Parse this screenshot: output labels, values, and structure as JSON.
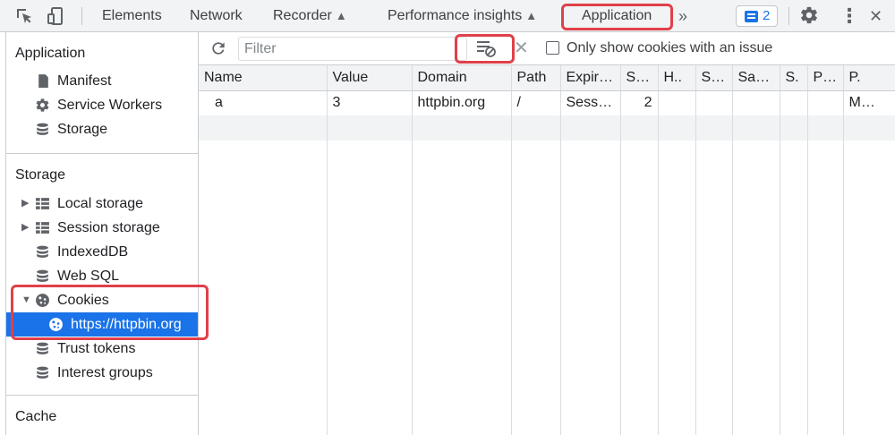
{
  "toolbar": {
    "tabs": [
      {
        "label": "Elements"
      },
      {
        "label": "Network"
      },
      {
        "label": "Recorder",
        "experimental": true
      },
      {
        "label": "Performance insights",
        "experimental": true
      },
      {
        "label": "Application",
        "active": true
      }
    ],
    "more_glyph": "»",
    "issues_count": "2",
    "icons": [
      "inspect-element-icon",
      "device-toggle-icon",
      "flask-icon",
      "chevron-double-right-icon",
      "message-icon",
      "gear-icon",
      "kebab-menu-icon",
      "close-icon"
    ],
    "close_glyph": "✕",
    "kebab_glyph": "⋮"
  },
  "sidebar": {
    "application_section": {
      "title": "Application",
      "items": [
        {
          "label": "Manifest",
          "icon": "document-icon"
        },
        {
          "label": "Service Workers",
          "icon": "gear-icon"
        },
        {
          "label": "Storage",
          "icon": "database-icon"
        }
      ]
    },
    "storage_section": {
      "title": "Storage",
      "items": [
        {
          "label": "Local storage",
          "icon": "grid-icon",
          "expandable": true
        },
        {
          "label": "Session storage",
          "icon": "grid-icon",
          "expandable": true
        },
        {
          "label": "IndexedDB",
          "icon": "database-icon"
        },
        {
          "label": "Web SQL",
          "icon": "database-icon"
        },
        {
          "label": "Cookies",
          "icon": "cookie-icon",
          "expanded": true
        },
        {
          "label": "https://httpbin.org",
          "icon": "cookie-icon",
          "selected": true
        },
        {
          "label": "Trust tokens",
          "icon": "database-icon"
        },
        {
          "label": "Interest groups",
          "icon": "database-icon"
        }
      ]
    },
    "cache_section": {
      "title": "Cache"
    }
  },
  "filterbar": {
    "filter_placeholder": "Filter",
    "clear_glyph": "✕",
    "only_issues_label": "Only show cookies with an issue",
    "only_issues_checked": false
  },
  "cookies_table": {
    "columns": [
      "Name",
      "Value",
      "Domain",
      "Path",
      "Expir…",
      "S…",
      "H..",
      "S…",
      "Sa…",
      "S.",
      "P…",
      "P."
    ],
    "rows": [
      [
        "a",
        "3",
        "httpbin.org",
        "/",
        "Sess…",
        "2",
        "",
        "",
        "",
        "",
        "",
        "M…"
      ]
    ]
  },
  "colors": {
    "accent": "#1a73e8",
    "highlight_box": "#e0404a",
    "toolbar_bg": "#f1f3f4"
  }
}
